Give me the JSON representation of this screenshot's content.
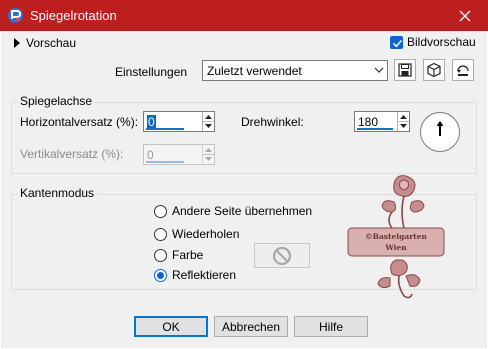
{
  "window": {
    "title": "Spiegelrotation",
    "title_bar_color": "#bd1f1f"
  },
  "top": {
    "preview_label": "Vorschau",
    "image_preview_label": "Bildvorschau",
    "image_preview_checked": true,
    "settings_label": "Einstellungen",
    "settings_value": "Zuletzt verwendet",
    "icons": [
      "save-icon",
      "load-preset-icon",
      "reset-icon"
    ]
  },
  "mirror_axis": {
    "group_title": "Spiegelachse",
    "horizontal_offset_label": "Horizontalversatz (%):",
    "horizontal_offset_value": "0",
    "vertical_offset_label": "Vertikalversatz (%):",
    "vertical_offset_value": "0",
    "rotation_label": "Drehwinkel:",
    "rotation_value": "180"
  },
  "edge_mode": {
    "group_title": "Kantenmodus",
    "options": [
      {
        "label": "Andere Seite übernehmen",
        "checked": false
      },
      {
        "label": "Wiederholen",
        "checked": false
      },
      {
        "label": "Farbe",
        "checked": false
      },
      {
        "label": "Reflektieren",
        "checked": true
      }
    ]
  },
  "watermark": {
    "line1": "©Bastelgarten",
    "line2": "Wien"
  },
  "buttons": {
    "ok": "OK",
    "cancel": "Abbrechen",
    "help": "Hilfe"
  },
  "colors": {
    "accent": "#0a64d4",
    "watermark": "#b07070"
  }
}
